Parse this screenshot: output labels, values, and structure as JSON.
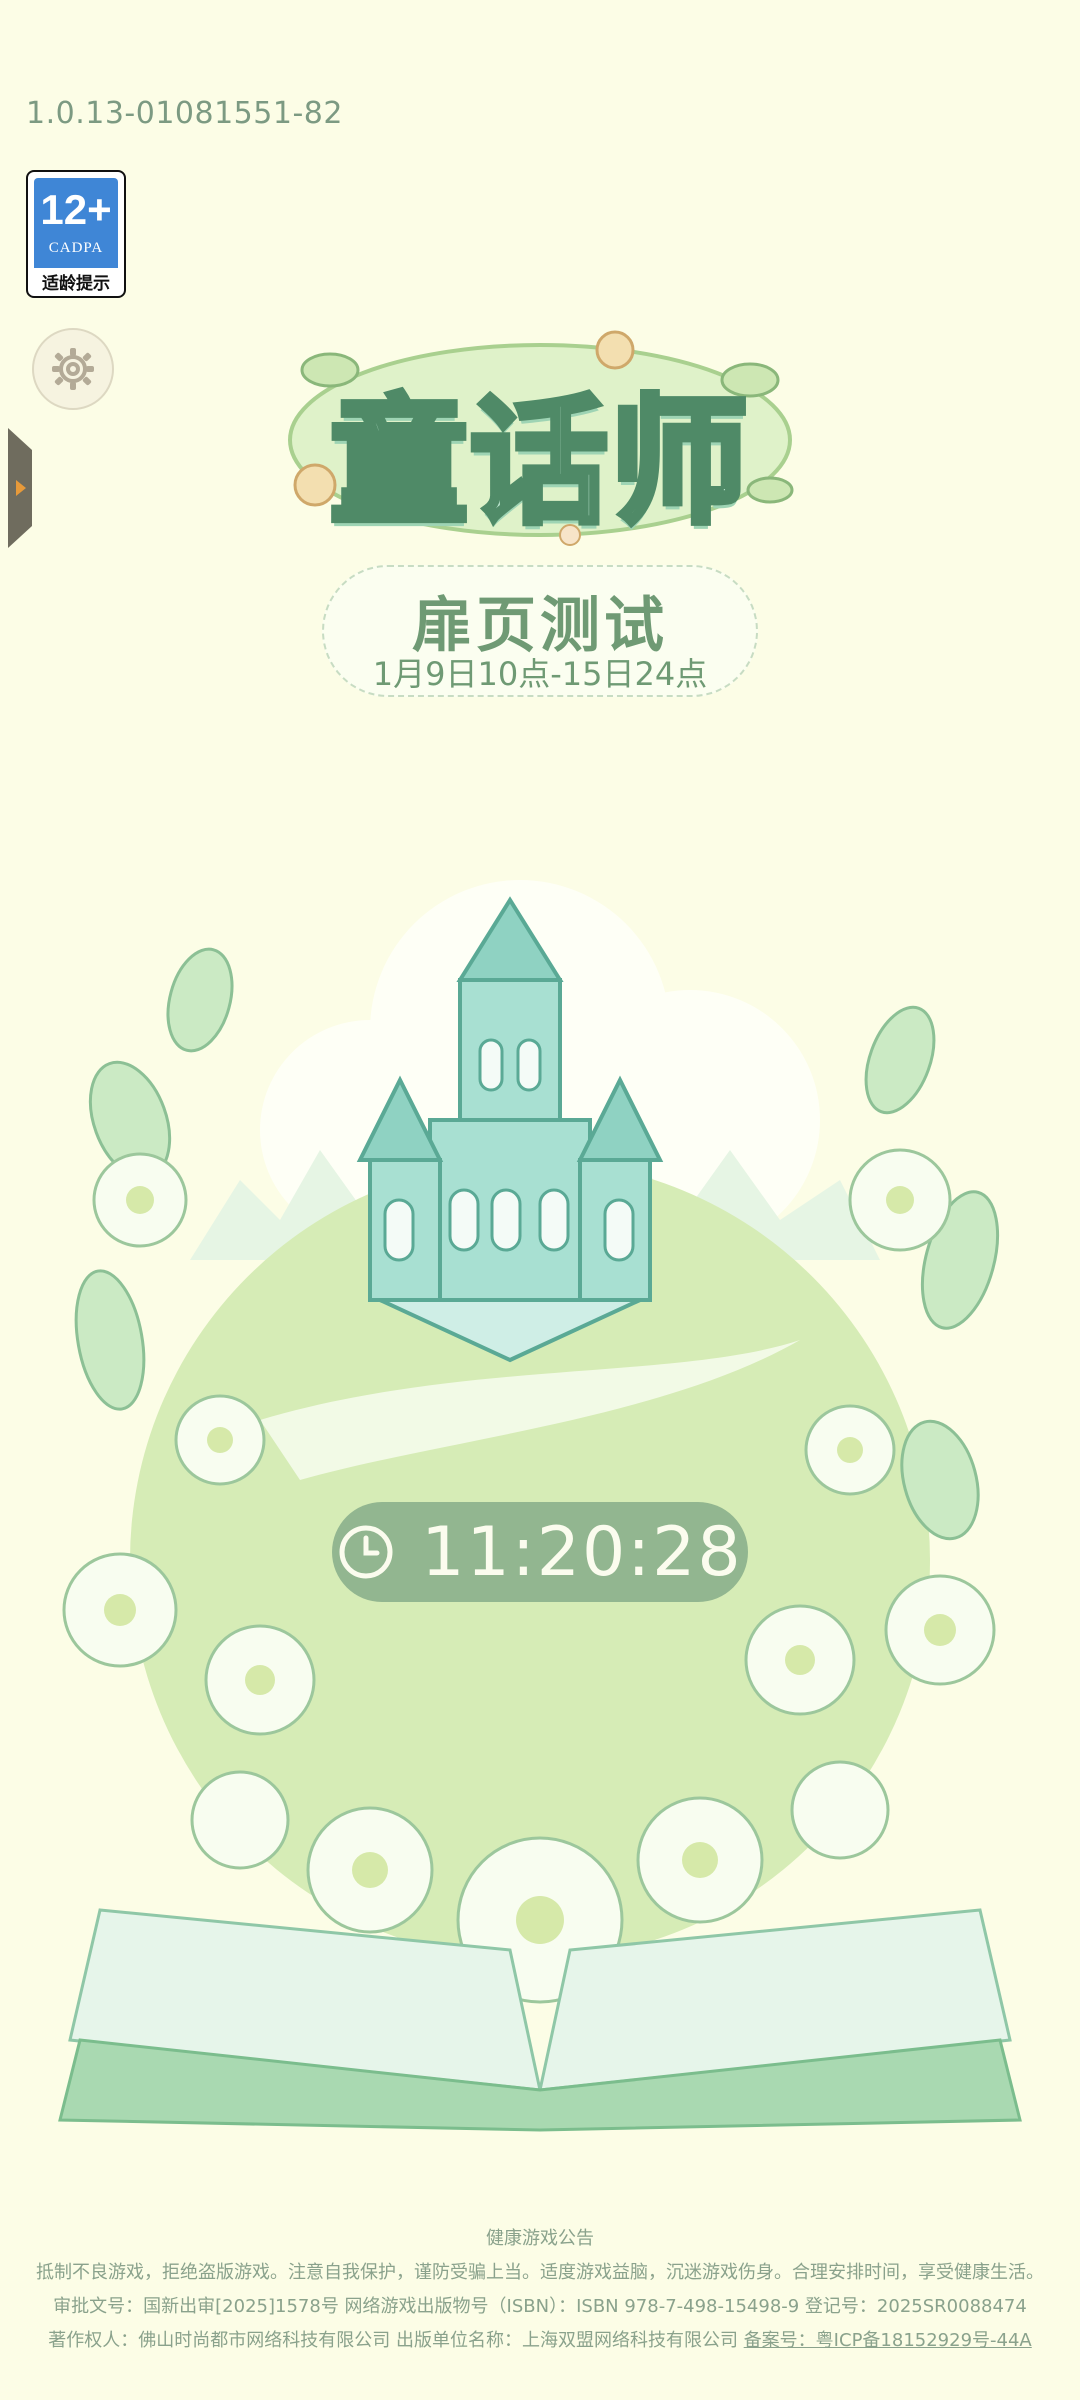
{
  "version": "1.0.13-01081551-82",
  "age_badge": {
    "rating": "12+",
    "org": "CADPA",
    "tip": "适龄提示"
  },
  "logo": {
    "title": "童话师"
  },
  "event": {
    "title": "扉页测试",
    "dates": "1月9日10点-15日24点"
  },
  "timer": {
    "time": "11:20:28",
    "icon": "clock-icon"
  },
  "footer": {
    "heading": "健康游戏公告",
    "notice": "抵制不良游戏，拒绝盗版游戏。注意自我保护，谨防受骗上当。适度游戏益脑，沉迷游戏伤身。合理安排时间，享受健康生活。",
    "line3": "审批文号：国新出审[2025]1578号  网络游戏出版物号（ISBN）：ISBN 978-7-498-15498-9  登记号：2025SR0088474",
    "line4_prefix": "著作权人：佛山时尚都市网络科技有限公司  出版单位名称：上海双盟网络科技有限公司  ",
    "icp_link": "备案号：粤ICP备18152929号-44A"
  },
  "colors": {
    "background": "#fcfde6",
    "accent": "#8fb48e",
    "text": "#6c8a70"
  }
}
